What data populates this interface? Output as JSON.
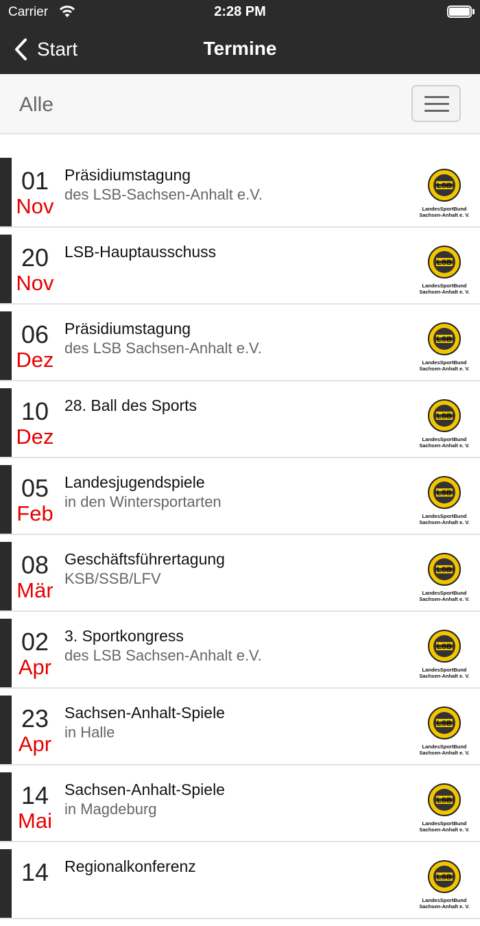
{
  "status_bar": {
    "carrier": "Carrier",
    "time": "2:28 PM"
  },
  "nav": {
    "back_label": "Start",
    "title": "Termine"
  },
  "filter": {
    "label": "Alle"
  },
  "logo": {
    "line1": "LandesSportBund",
    "line2": "Sachsen-Anhalt e. V.",
    "badge": "LSB"
  },
  "events": [
    {
      "day": "01",
      "month": "Nov",
      "title": "Präsidiumstagung",
      "subtitle": "des LSB-Sachsen-Anhalt e.V."
    },
    {
      "day": "20",
      "month": "Nov",
      "title": "LSB-Hauptausschuss",
      "subtitle": ""
    },
    {
      "day": "06",
      "month": "Dez",
      "title": "Präsidiumstagung",
      "subtitle": "des LSB Sachsen-Anhalt e.V."
    },
    {
      "day": "10",
      "month": "Dez",
      "title": "28. Ball des Sports",
      "subtitle": ""
    },
    {
      "day": "05",
      "month": "Feb",
      "title": "Landesjugendspiele",
      "subtitle": "in den Wintersportarten"
    },
    {
      "day": "08",
      "month": "Mär",
      "title": "Geschäftsführertagung",
      "subtitle": "KSB/SSB/LFV"
    },
    {
      "day": "02",
      "month": "Apr",
      "title": "3. Sportkongress",
      "subtitle": "des LSB Sachsen-Anhalt e.V."
    },
    {
      "day": "23",
      "month": "Apr",
      "title": "Sachsen-Anhalt-Spiele",
      "subtitle": "in Halle"
    },
    {
      "day": "14",
      "month": "Mai",
      "title": "Sachsen-Anhalt-Spiele",
      "subtitle": "in Magdeburg"
    },
    {
      "day": "14",
      "month": "",
      "title": "Regionalkonferenz",
      "subtitle": ""
    }
  ]
}
